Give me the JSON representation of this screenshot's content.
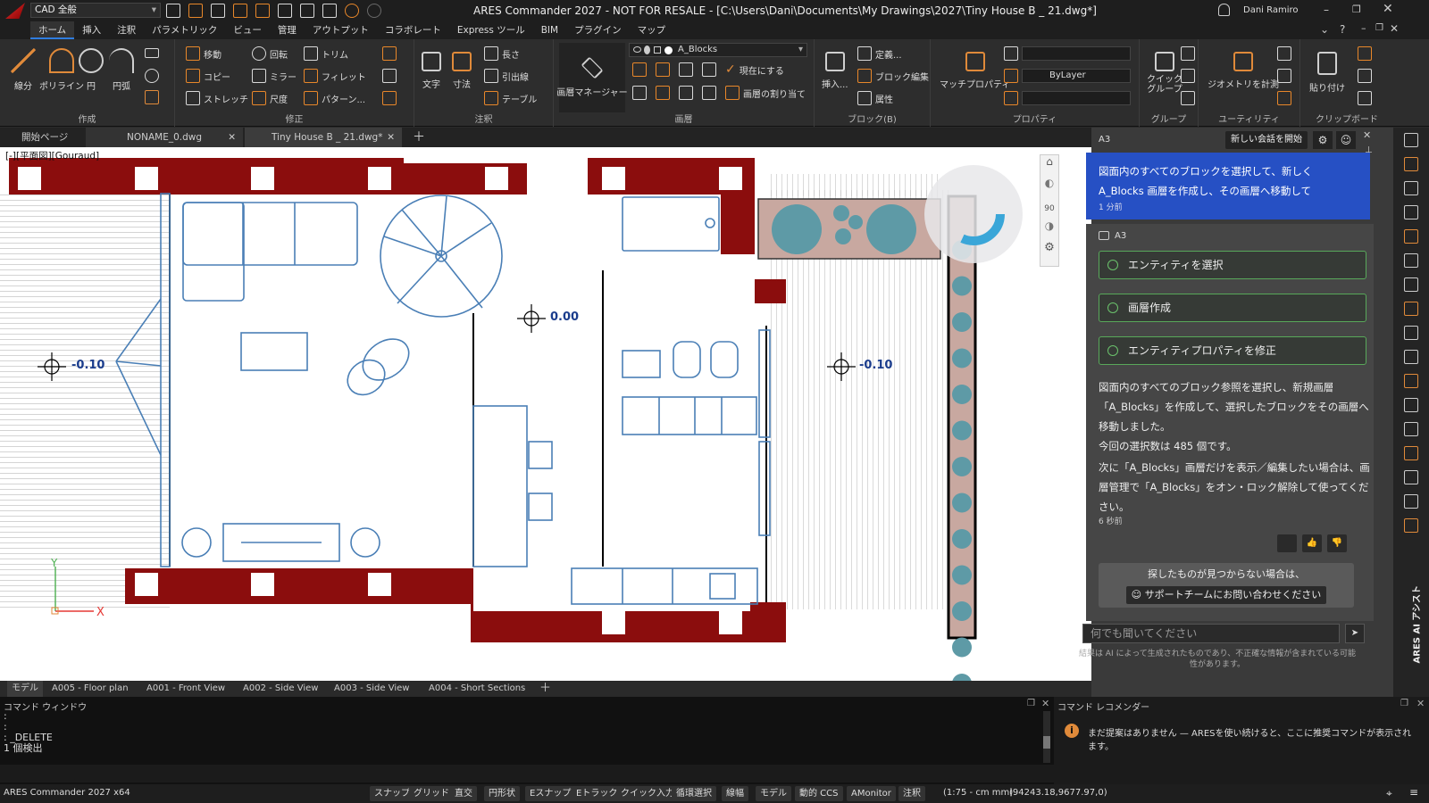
{
  "titlebar": {
    "workspace": "CAD 全般",
    "title": "ARES Commander 2027 - NOT FOR RESALE - [C:\\Users\\Dani\\Documents\\My Drawings\\2027\\Tiny House B _ 21.dwg*]",
    "user": "Dani Ramiro"
  },
  "menu": [
    "ホーム",
    "挿入",
    "注釈",
    "パラメトリック",
    "ビュー",
    "管理",
    "アウトプット",
    "コラボレート",
    "Express ツール",
    "BIM",
    "プラグイン",
    "マップ"
  ],
  "ribbon": {
    "draw": {
      "label": "作成",
      "line": "線分",
      "polyline": "ポリライン",
      "circle": "円",
      "arc": "円弧"
    },
    "modify": {
      "label": "修正",
      "move": "移動",
      "rotate": "回転",
      "trim": "トリム",
      "copy": "コピー",
      "mirror": "ミラー",
      "fillet": "フィレット",
      "stretch": "ストレッチ",
      "scale": "尺度",
      "pattern": "パターン..."
    },
    "annotation": {
      "label": "注釈",
      "text": "文字",
      "dimension": "寸法",
      "length": "長さ",
      "leader": "引出線",
      "table": "テーブル"
    },
    "layers": {
      "label": "画層",
      "manager": "画層マネージャー",
      "current_layer": "A_Blocks",
      "set_current": "現在にする",
      "assign": "画層の割り当て"
    },
    "block": {
      "label": "ブロック(B)",
      "insert": "挿入...",
      "define": "定義...",
      "edit": "ブロック編集",
      "attribute": "属性"
    },
    "properties": {
      "label": "プロパティ",
      "match": "マッチプロパティ",
      "linetype": "ByLayer"
    },
    "group": {
      "label": "グループ",
      "quick": "クイック\nグループ"
    },
    "utility": {
      "label": "ユーティリティ",
      "measure": "ジオメトリを計測"
    },
    "clipboard": {
      "label": "クリップボード",
      "paste": "貼り付け"
    }
  },
  "doc_tabs": [
    "開始ページ",
    "NONAME_0.dwg",
    "Tiny House B _ 21.dwg*"
  ],
  "canvas": {
    "view_label": "[-][平面図][Gouraud]",
    "levels": [
      "-0.10",
      "0.00",
      "-0.10"
    ],
    "viewcube_angle": "90"
  },
  "layout_tabs": [
    "モデル",
    "A005 - Floor plan",
    "A001 - Front View",
    "A002 - Side View",
    "A003 - Side View",
    "A004 - Short Sections"
  ],
  "ai": {
    "panel_title": "A3",
    "new_chat": "新しい会話を開始",
    "user_msg": "図面内のすべてのブロックを選択して、新しく A_Blocks 画層を作成し、その画層へ移動して",
    "user_time": "1 分前",
    "assistant_name": "A3",
    "steps": [
      "エンティティを選択",
      "画層作成",
      "エンティティプロパティを修正"
    ],
    "reply": [
      "図面内のすべてのブロック参照を選択し、新規画層「A_Blocks」を作成して、選択したブロックをその画層へ移動しました。",
      "今回の選択数は 485 個です。",
      "次に「A_Blocks」画層だけを表示／編集したい場合は、画層管理で「A_Blocks」をオン・ロック解除して使ってください。"
    ],
    "reply_time": "6 秒前",
    "support_title": "探したものが見つからない場合は、",
    "support_btn": "サポートチームにお問い合わせください",
    "input_placeholder": "何でも聞いてください",
    "disclaimer": "結果は AI によって生成されたものであり、不正確な情報が含まれている可能性があります。",
    "side_label": "ARES AI アシスト"
  },
  "command_window": {
    "title": "コマンド ウィンドウ",
    "lines": [
      ":",
      ":",
      ": _DELETE",
      "1 個検出"
    ]
  },
  "recommender": {
    "title": "コマンド レコメンダー",
    "message": "まだ提案はありません — ARESを使い続けると、ここに推奨コマンドが表示されます。"
  },
  "status": {
    "app": "ARES Commander 2027 x64",
    "toggles": [
      "スナップ",
      "グリッド",
      "直交",
      "円形状",
      "Eスナップ",
      "Eトラック",
      "クイック入力",
      "循環選択",
      "線幅",
      "モデル",
      "動的 CCS",
      "AMonitor",
      "注釈"
    ],
    "scale": "(1:75 - cm mm)",
    "coords": "(94243.18,9677.97,0)"
  },
  "colors": {
    "wall": "#8b0d0d",
    "accent": "#2650c4",
    "furniture": "#4a7fb6"
  }
}
